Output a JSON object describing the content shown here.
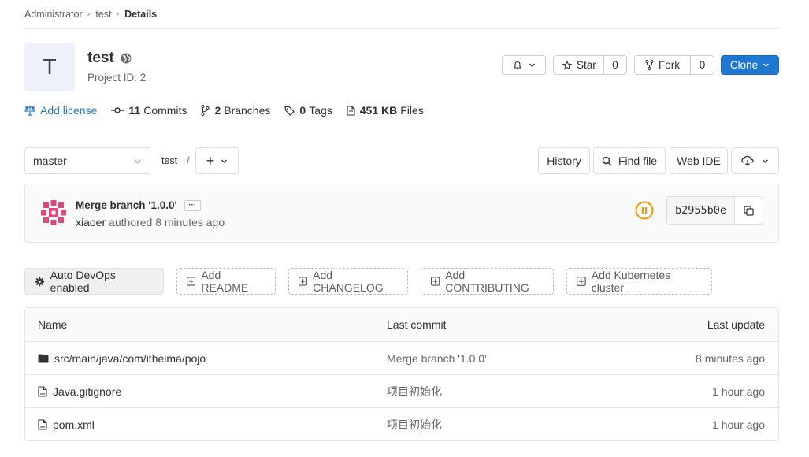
{
  "breadcrumb": {
    "items": [
      "Administrator",
      "test"
    ],
    "current": "Details"
  },
  "project": {
    "avatar_letter": "T",
    "name": "test",
    "id_label": "Project ID: 2"
  },
  "header_buttons": {
    "star_label": "Star",
    "star_count": "0",
    "fork_label": "Fork",
    "fork_count": "0",
    "clone_label": "Clone"
  },
  "stats": {
    "license_label": "Add license",
    "commits_count": "11",
    "commits_label": "Commits",
    "branches_count": "2",
    "branches_label": "Branches",
    "tags_count": "0",
    "tags_label": "Tags",
    "files_size": "451 KB",
    "files_label": "Files"
  },
  "repo_toolbar": {
    "branch": "master",
    "path": "test",
    "path_sep": "/",
    "history_label": "History",
    "find_file_label": "Find file",
    "web_ide_label": "Web IDE"
  },
  "last_commit": {
    "message": "Merge branch '1.0.0'",
    "author": "xiaoer",
    "meta": "authored 8 minutes ago",
    "sha": "b2955b0e",
    "ellipsis": "···"
  },
  "actions": {
    "auto_devops": "Auto DevOps enabled",
    "add_readme": "Add README",
    "add_changelog": "Add CHANGELOG",
    "add_contributing": "Add CONTRIBUTING",
    "add_k8s": "Add Kubernetes cluster"
  },
  "files": {
    "columns": {
      "name": "Name",
      "last_commit": "Last commit",
      "last_update": "Last update"
    },
    "rows": [
      {
        "type": "folder",
        "name": "src/main/java/com/itheima/pojo",
        "commit": "Merge branch '1.0.0'",
        "updated": "8 minutes ago"
      },
      {
        "type": "file",
        "name": "Java.gitignore",
        "commit": "项目初始化",
        "updated": "1 hour ago"
      },
      {
        "type": "file",
        "name": "pom.xml",
        "commit": "项目初始化",
        "updated": "1 hour ago"
      }
    ]
  },
  "colors": {
    "primary": "#1f78d1",
    "pipeline_running": "#fc9403",
    "avatar_pink": "#e0457b"
  }
}
